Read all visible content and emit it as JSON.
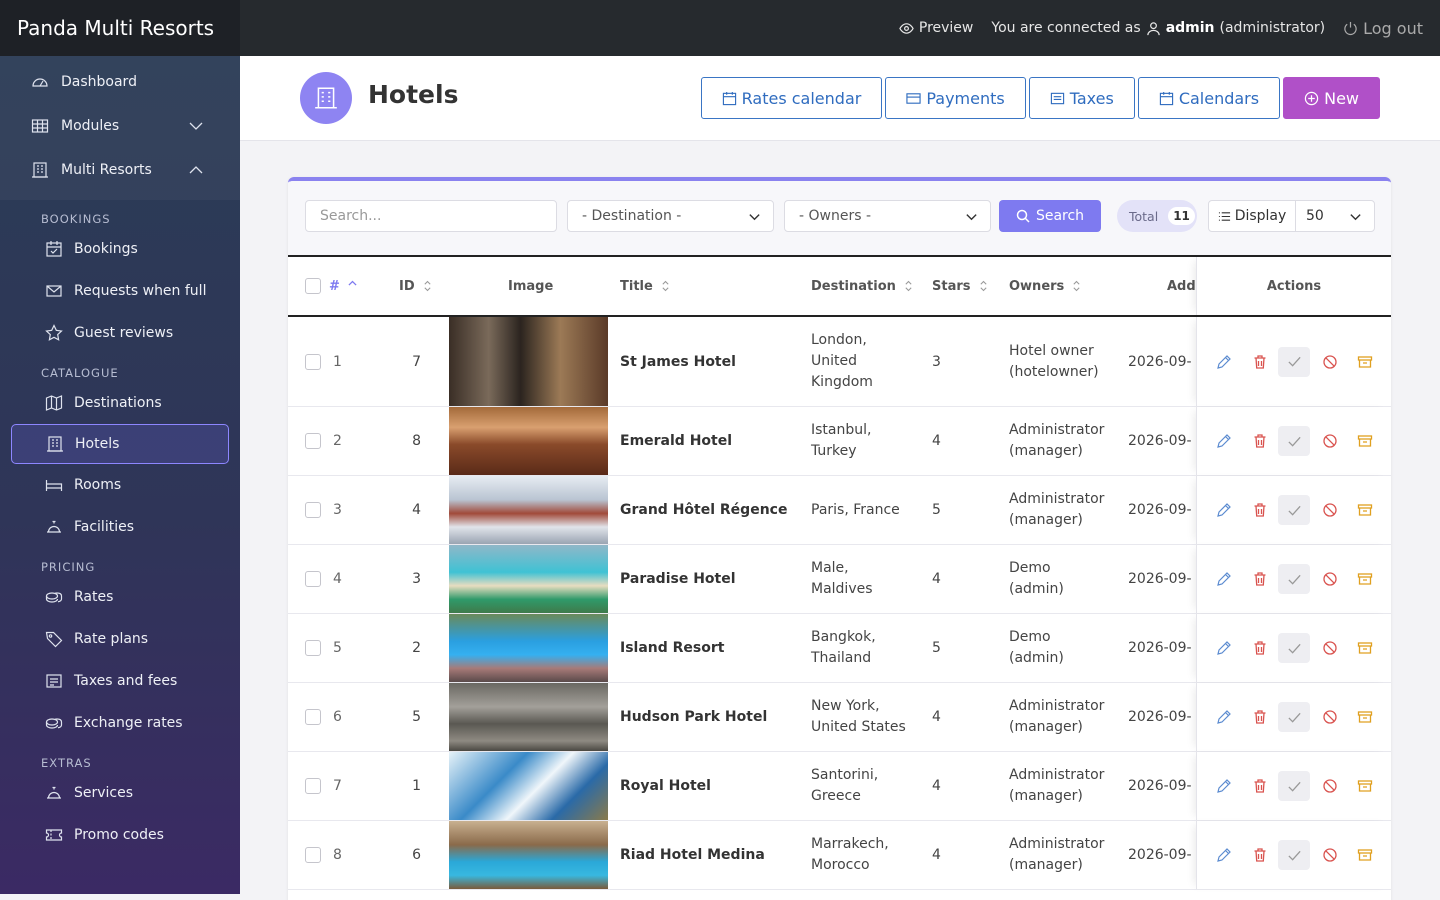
{
  "app": {
    "brand": "Panda Multi Resorts"
  },
  "topbar": {
    "preview": "Preview",
    "connected_prefix": "You are connected as",
    "user": "admin",
    "role": "(administrator)",
    "logout": "Log out"
  },
  "sidebar": {
    "top_items": [
      {
        "label": "Dashboard",
        "icon": "gauge-icon"
      },
      {
        "label": "Modules",
        "icon": "grid-icon"
      },
      {
        "label": "Multi Resorts",
        "icon": "building-icon"
      }
    ],
    "sections": {
      "bookings": "BOOKINGS",
      "catalogue": "CATALOGUE",
      "pricing": "PRICING",
      "extras": "EXTRAS"
    },
    "bookings": [
      {
        "label": "Bookings"
      },
      {
        "label": "Requests when full"
      },
      {
        "label": "Guest reviews"
      }
    ],
    "catalogue": [
      {
        "label": "Destinations"
      },
      {
        "label": "Hotels"
      },
      {
        "label": "Rooms"
      },
      {
        "label": "Facilities"
      }
    ],
    "pricing": [
      {
        "label": "Rates"
      },
      {
        "label": "Rate plans"
      },
      {
        "label": "Taxes and fees"
      },
      {
        "label": "Exchange rates"
      }
    ],
    "extras": [
      {
        "label": "Services"
      },
      {
        "label": "Promo codes"
      }
    ]
  },
  "header": {
    "title": "Hotels",
    "buttons": {
      "rates_calendar": "Rates calendar",
      "payments": "Payments",
      "taxes": "Taxes",
      "calendars": "Calendars",
      "new": "New"
    }
  },
  "filters": {
    "search_placeholder": "Search...",
    "destination": "- Destination -",
    "owners": "- Owners -",
    "search_button": "Search",
    "total_label": "Total",
    "total_count": "11",
    "display_label": "Display",
    "display_value": "50"
  },
  "table": {
    "headers": {
      "num": "#",
      "id": "ID",
      "image": "Image",
      "title": "Title",
      "destination": "Destination",
      "stars": "Stars",
      "owners": "Owners",
      "added": "Add",
      "actions": "Actions"
    },
    "rows": [
      {
        "num": "1",
        "id": "7",
        "title": "St James Hotel",
        "dest1": "London,",
        "dest2": "United",
        "dest3": "Kingdom",
        "stars": "3",
        "owner1": "Hotel owner",
        "owner2": "(hotelowner)",
        "added": "2026-09-"
      },
      {
        "num": "2",
        "id": "8",
        "title": "Emerald Hotel",
        "dest1": "Istanbul,",
        "dest2": "Turkey",
        "dest3": "",
        "stars": "4",
        "owner1": "Administrator",
        "owner2": "(manager)",
        "added": "2026-09-"
      },
      {
        "num": "3",
        "id": "4",
        "title": "Grand Hôtel Régence",
        "dest1": "Paris, France",
        "dest2": "",
        "dest3": "",
        "stars": "5",
        "owner1": "Administrator",
        "owner2": "(manager)",
        "added": "2026-09-"
      },
      {
        "num": "4",
        "id": "3",
        "title": "Paradise Hotel",
        "dest1": "Male,",
        "dest2": "Maldives",
        "dest3": "",
        "stars": "4",
        "owner1": "Demo",
        "owner2": "(admin)",
        "added": "2026-09-"
      },
      {
        "num": "5",
        "id": "2",
        "title": "Island Resort",
        "dest1": "Bangkok,",
        "dest2": "Thailand",
        "dest3": "",
        "stars": "5",
        "owner1": "Demo",
        "owner2": "(admin)",
        "added": "2026-09-"
      },
      {
        "num": "6",
        "id": "5",
        "title": "Hudson Park Hotel",
        "dest1": "New York,",
        "dest2": "United States",
        "dest3": "",
        "stars": "4",
        "owner1": "Administrator",
        "owner2": "(manager)",
        "added": "2026-09-"
      },
      {
        "num": "7",
        "id": "1",
        "title": "Royal Hotel",
        "dest1": "Santorini,",
        "dest2": "Greece",
        "dest3": "",
        "stars": "4",
        "owner1": "Administrator",
        "owner2": "(manager)",
        "added": "2026-09-"
      },
      {
        "num": "8",
        "id": "6",
        "title": "Riad Hotel Medina",
        "dest1": "Marrakech,",
        "dest2": "Morocco",
        "dest3": "",
        "stars": "4",
        "owner1": "Administrator",
        "owner2": "(manager)",
        "added": "2026-09-"
      }
    ]
  },
  "colors": {
    "accent": "#7e7af0",
    "new_button": "#b050c8",
    "outline_button": "#2f6cbf",
    "delete": "#d9534f",
    "archive": "#e0a020"
  }
}
